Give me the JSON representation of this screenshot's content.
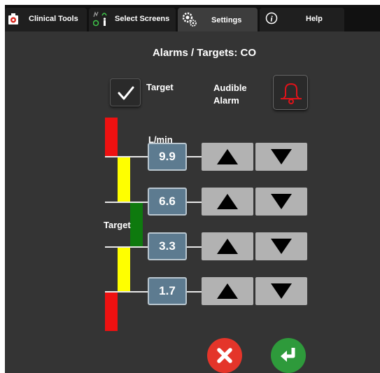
{
  "tabs": [
    {
      "label": "Clinical Tools",
      "icon": "medical-kit-icon"
    },
    {
      "label": "Select Screens",
      "icon": "screen-select-icon"
    },
    {
      "label": "Settings",
      "icon": "gear-icon",
      "active": true
    },
    {
      "label": "Help",
      "icon": "info-icon"
    }
  ],
  "page": {
    "title": "Alarms / Targets: CO",
    "target_checkbox": {
      "label": "Target",
      "checked": true
    },
    "audible_alarm": {
      "label_line1": "Audible",
      "label_line2": "Alarm",
      "icon": "bell-icon",
      "color": "#e0131a"
    },
    "unit": "L/min",
    "side_label": "Target"
  },
  "limits": [
    {
      "value": "9.9"
    },
    {
      "value": "6.6"
    },
    {
      "value": "3.3"
    },
    {
      "value": "1.7"
    }
  ],
  "zone_colors": {
    "red": "#ee1111",
    "yellow": "#ffff00",
    "green": "#0e7a0e"
  },
  "buttons": {
    "cancel": {
      "icon": "cancel-x-icon",
      "color": "#e4352a"
    },
    "confirm": {
      "icon": "enter-return-icon",
      "color": "#2e9a3b"
    }
  }
}
